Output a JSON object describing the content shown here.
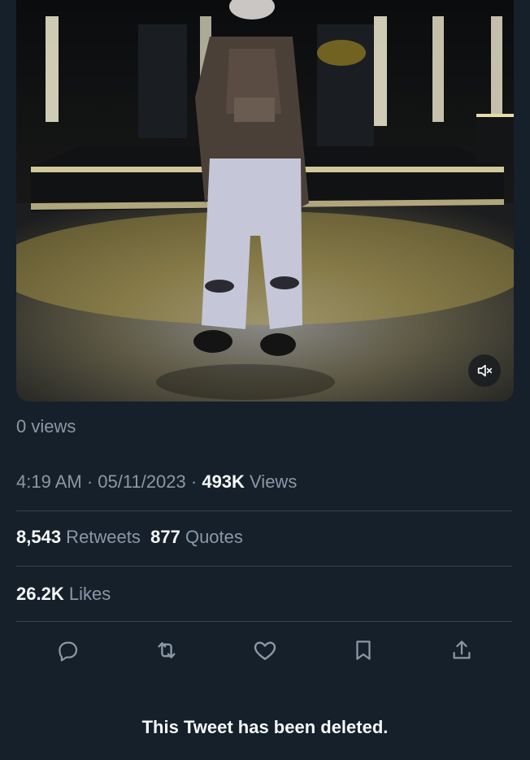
{
  "media": {
    "mute_icon": "volume-muted-icon"
  },
  "views_label": "0 views",
  "meta": {
    "time": "4:19 AM",
    "sep1": " · ",
    "date": "05/11/2023",
    "sep2": " · ",
    "views_count": "493K",
    "views_label": " Views"
  },
  "stats": {
    "retweets_count": "8,543",
    "retweets_label": " Retweets",
    "quotes_count": "877",
    "quotes_label": " Quotes",
    "likes_count": "26.2K",
    "likes_label": " Likes"
  },
  "actions": {
    "icons": [
      "reply-icon",
      "retweet-icon",
      "like-icon",
      "bookmark-icon",
      "share-icon"
    ]
  },
  "deleted_notice": "This Tweet has been deleted.",
  "colors": {
    "background": "#15202b",
    "secondary_text": "#8b98a5",
    "primary_text": "#f7f9f9",
    "divider": "#38444d",
    "stage_light": "#e8c84a"
  }
}
